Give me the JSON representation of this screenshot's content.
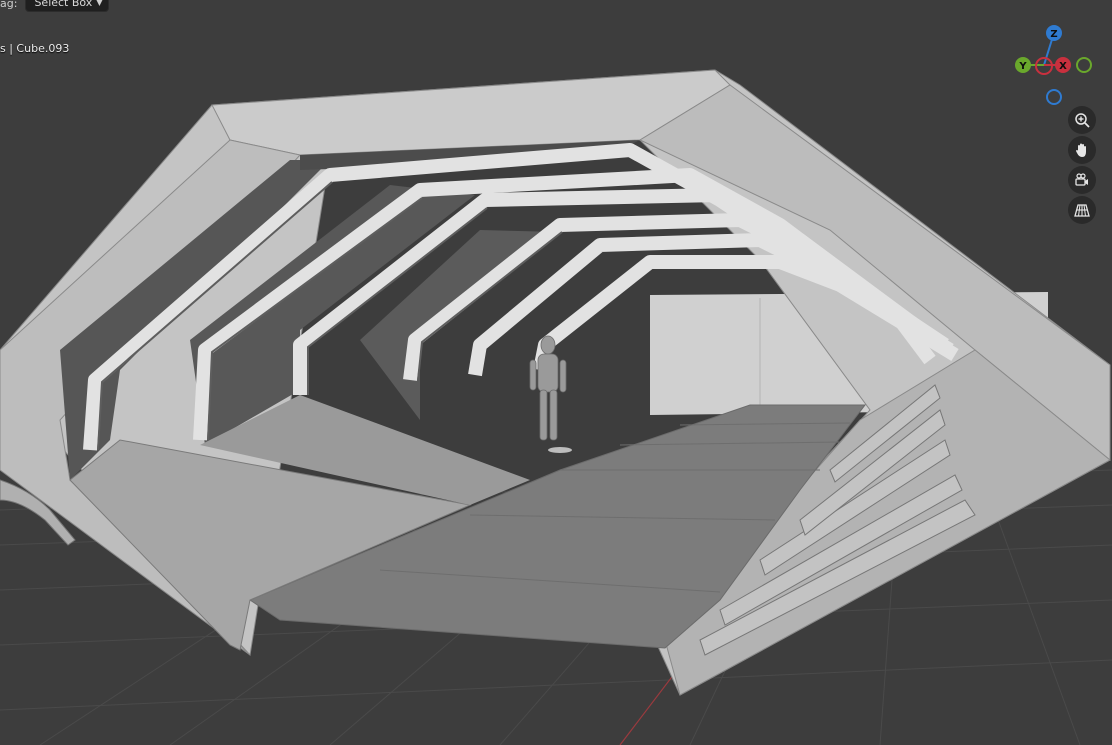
{
  "header": {
    "drag_label": "ag:",
    "drag_value": "Select Box",
    "object_info": "s | Cube.093"
  },
  "gizmo": {
    "axes": [
      {
        "name": "Z",
        "color": "#2f7bd1"
      },
      {
        "name": "Y",
        "color": "#6aa82c"
      },
      {
        "name": "X",
        "color": "#c9303e"
      }
    ]
  },
  "nav_buttons": [
    {
      "name": "zoom-icon"
    },
    {
      "name": "hand-icon"
    },
    {
      "name": "camera-icon"
    },
    {
      "name": "grid-icon"
    }
  ],
  "colors": {
    "background": "#3d3d3d",
    "grid_line": "#4a4a4a",
    "mesh_light": "#c6c6c6",
    "mesh_dark": "#5a5a5a",
    "floor": "#7e7e7e"
  }
}
